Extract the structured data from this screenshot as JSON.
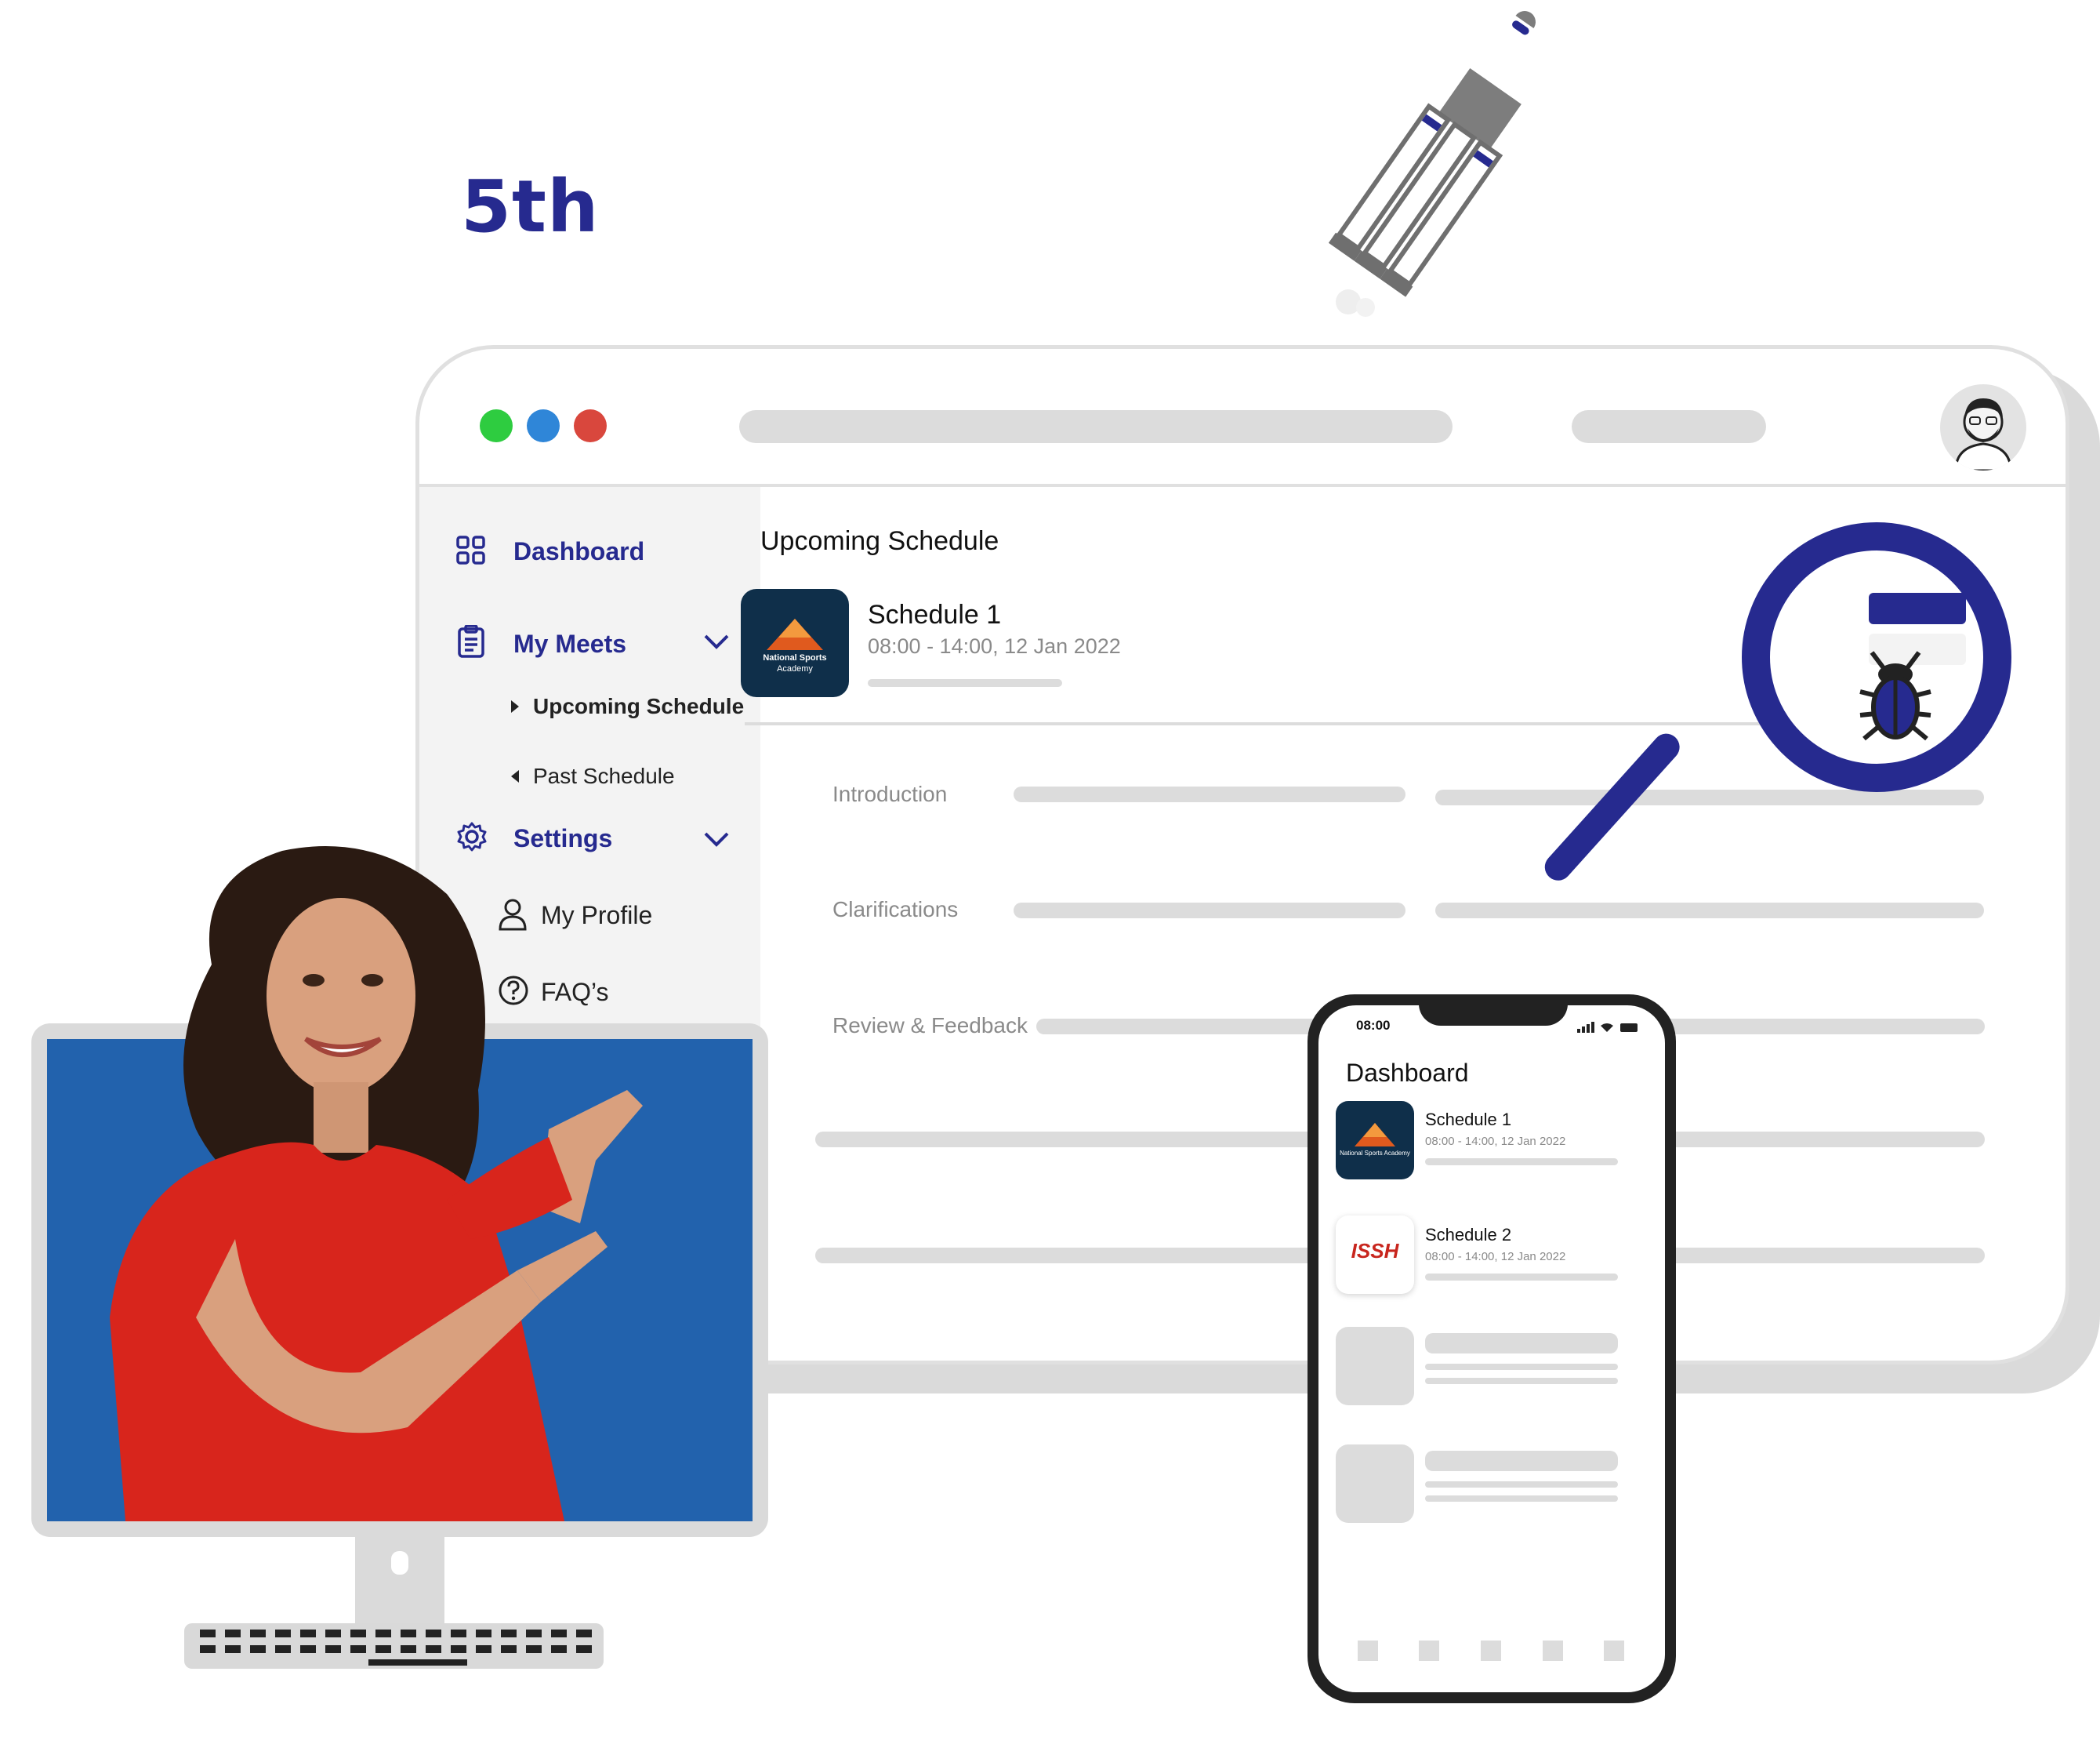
{
  "step_label": "5th",
  "window": {
    "traffic_lights": [
      "#2ecc40",
      "#2f86d8",
      "#d9473d"
    ],
    "avatar_icon": "user-avatar"
  },
  "sidebar": {
    "dashboard": "Dashboard",
    "my_meets": "My Meets",
    "upcoming_schedule": "Upcoming Schedule",
    "past_schedule": "Past Schedule",
    "settings": "Settings",
    "my_profile": "My Profile",
    "faqs": "FAQ’s"
  },
  "main": {
    "section_title": "Upcoming Schedule",
    "schedule": {
      "title": "Schedule 1",
      "time": "08:00 - 14:00, 12 Jan 2022",
      "logo_text_1": "National Sports",
      "logo_text_2": "Academy"
    },
    "rows": [
      "Introduction",
      "Clarifications",
      "Review & Feedback"
    ]
  },
  "phone": {
    "time": "08:00",
    "title": "Dashboard",
    "items": [
      {
        "title": "Schedule 1",
        "time": "08:00 - 14:00, 12 Jan 2022",
        "logo": "National Sports Academy"
      },
      {
        "title": "Schedule 2",
        "time": "08:00 - 14:00, 12 Jan 2022",
        "logo": "ISSH"
      }
    ]
  },
  "colors": {
    "brand": "#262a8f",
    "monitor_screen": "#2262ad",
    "placeholder": "#dcdcdc"
  }
}
